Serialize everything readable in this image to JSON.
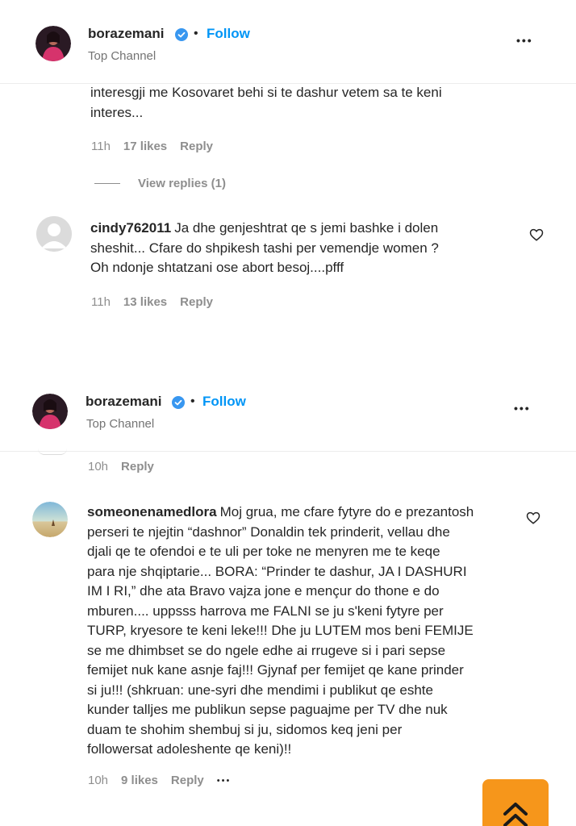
{
  "panel1": {
    "header": {
      "username": "borazemani",
      "follow_label": "Follow",
      "subtitle": "Top Channel",
      "separator": "•",
      "more_label": "•••"
    },
    "partial_comment": {
      "lines": [
        "interesgji me Kosovaret behi si te dashur vetem sa te keni",
        "interes..."
      ],
      "time": "11h",
      "likes": "17 likes",
      "reply_label": "Reply"
    },
    "view_replies_label": "View replies (1)",
    "comment2": {
      "username": "cindy762011",
      "line1": "Ja dhe genjeshtrat qe s jemi bashke i dolen",
      "line2": "sheshit... Cfare do shpikesh tashi per vemendje women ?",
      "line3": "Oh ndonje shtatzani ose abort besoj....pfff",
      "time": "11h",
      "likes": "13 likes",
      "reply_label": "Reply"
    }
  },
  "panel2": {
    "header": {
      "username": "borazemani",
      "follow_label": "Follow",
      "subtitle": "Top Channel",
      "separator": "•",
      "more_label": "•••"
    },
    "partial_meta": {
      "time": "10h",
      "reply_label": "Reply"
    },
    "comment": {
      "username": "someonenamedlora",
      "first_line": "Moj grua, me cfare fytyre do e prezantosh",
      "lines": [
        "perseri te njejtin “dashnor” Donaldin tek prinderit, vellau dhe",
        "djali qe te ofendoi e te uli per toke ne menyren me te keqe",
        "para nje shqiptarie... BORA: “Prinder te dashur, JA I DASHURI",
        "IM I RI,” dhe ata Bravo vajza jone e mençur do thone e do",
        "mburen.... uppsss harrova me FALNI se ju s'keni fytyre per",
        "TURP, kryesore te keni leke!!! Dhe ju LUTEM mos beni FEMIJE",
        "se me dhimbset se do ngele edhe ai rrugeve si i pari sepse",
        "femijet nuk kane asnje faj!!! Gjynaf per femijet qe kane prinder",
        "si ju!!! (shkruan: une-syri dhe mendimi i publikut qe eshte",
        "kunder talljes me publikun sepse paguajme per TV dhe nuk",
        "duam te shohim shembuj si ju, sidomos keq jeni per",
        "followersat adoleshente qe keni)!!"
      ],
      "time": "10h",
      "likes": "9 likes",
      "reply_label": "Reply",
      "more_label": "•••"
    }
  },
  "colors": {
    "accent": "#0095f6",
    "verified": "#3897f0",
    "scroll_button": "#f6961b"
  },
  "icons": {
    "verified": "verified-badge-icon",
    "heart": "heart-outline-icon",
    "scroll": "double-chevron-up-icon"
  }
}
